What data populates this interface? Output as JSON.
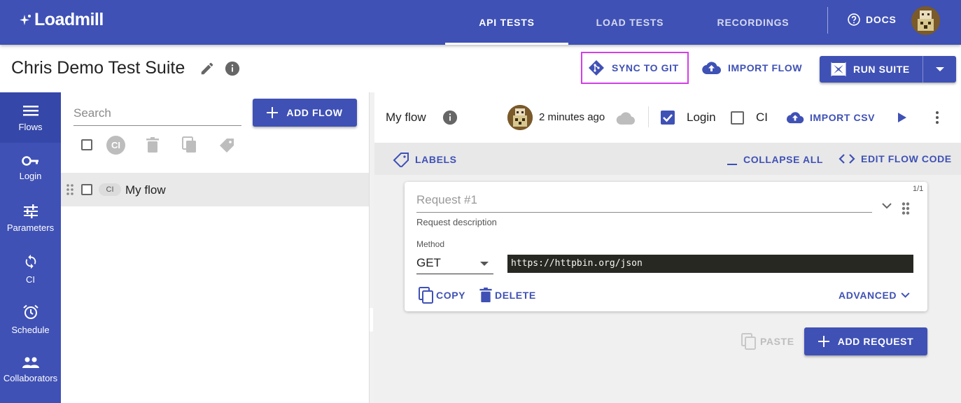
{
  "app": {
    "logo_text": "Loadmill",
    "nav_tabs": [
      {
        "label": "API TESTS",
        "active": true
      },
      {
        "label": "LOAD TESTS",
        "active": false
      },
      {
        "label": "RECORDINGS",
        "active": false
      }
    ],
    "docs_label": "DOCS"
  },
  "suite": {
    "title": "Chris Demo Test Suite",
    "sync_label": "SYNC TO GIT",
    "import_flow_label": "IMPORT FLOW",
    "run_suite_label": "RUN SUITE"
  },
  "leftnav": {
    "items": [
      {
        "label": "Flows",
        "icon": "menu-icon"
      },
      {
        "label": "Login",
        "icon": "key-icon"
      },
      {
        "label": "Parameters",
        "icon": "tune-icon"
      },
      {
        "label": "CI",
        "icon": "sync-icon"
      },
      {
        "label": "Schedule",
        "icon": "alarm-icon"
      },
      {
        "label": "Collaborators",
        "icon": "people-icon"
      }
    ]
  },
  "flowlist": {
    "search_placeholder": "Search",
    "add_flow_label": "ADD FLOW",
    "ci_chip": "CI",
    "flows": [
      {
        "name": "My flow",
        "badge": "CI"
      }
    ]
  },
  "flow": {
    "name": "My flow",
    "updated": "2 minutes ago",
    "login_label": "Login",
    "login_checked": true,
    "ci_label": "CI",
    "ci_checked": false,
    "import_csv_label": "IMPORT CSV",
    "labels_label": "LABELS",
    "collapse_all_label": "COLLAPSE ALL",
    "edit_code_label": "EDIT FLOW CODE",
    "request": {
      "counter": "1/1",
      "title_placeholder": "Request #1",
      "description_placeholder": "Request description",
      "method_label": "Method",
      "method": "GET",
      "url": "https://httpbin.org/json",
      "copy_label": "COPY",
      "delete_label": "DELETE",
      "advanced_label": "ADVANCED"
    },
    "paste_label": "PASTE",
    "add_request_label": "ADD REQUEST"
  },
  "colors": {
    "primary": "#3f51b5",
    "highlight_border": "#d23fe6",
    "code_bg": "#272822"
  }
}
